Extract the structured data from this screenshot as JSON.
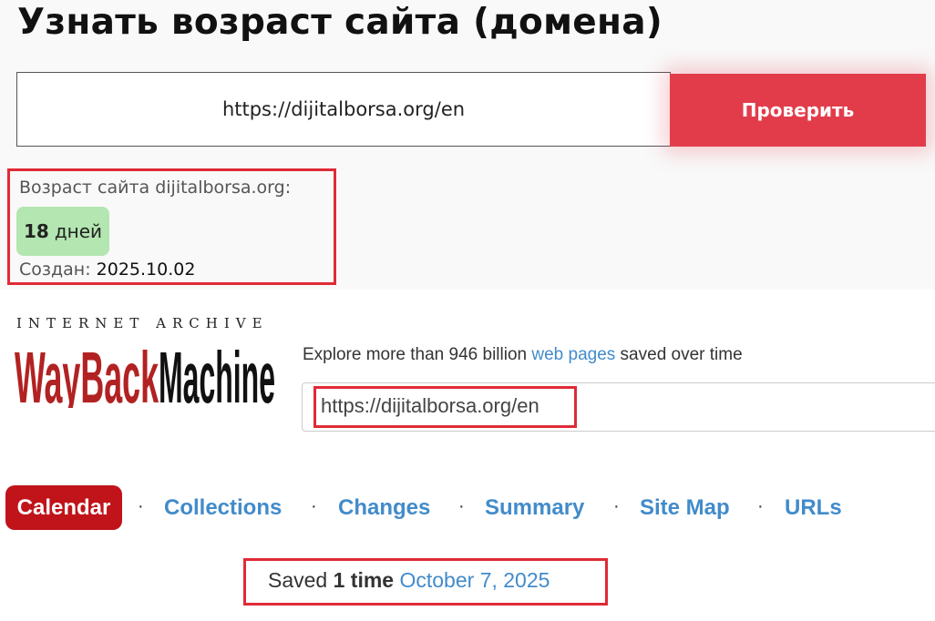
{
  "age_checker": {
    "title": "Узнать возраст сайта (домена)",
    "url_input_value": "https://dijitalborsa.org/en",
    "check_button_label": "Проверить",
    "result_label": "Возраст сайта dijitalborsa.org:",
    "age_value": "18",
    "age_unit": "дней",
    "created_label": "Создан:",
    "created_date": "2025.10.02",
    "colors": {
      "button": "#e23c4b",
      "badge": "#b3e6b1",
      "highlight": "#e02a37"
    }
  },
  "wayback": {
    "org_text": "INTERNET ARCHIVE",
    "logo_left": "WayBack",
    "logo_right": "Machine",
    "explore_before": "Explore more than 946 billion ",
    "explore_link": "web pages",
    "explore_after": " saved over time",
    "search_value": "https://dijitalborsa.org/en",
    "tabs": [
      {
        "label": "Calendar",
        "active": true
      },
      {
        "label": "Collections"
      },
      {
        "label": "Changes"
      },
      {
        "label": "Summary"
      },
      {
        "label": "Site Map"
      },
      {
        "label": "URLs"
      }
    ],
    "tab_separator": "·",
    "saved_prefix": "Saved",
    "saved_count": "1 time",
    "saved_date": "October 7, 2025",
    "colors": {
      "logo_red": "#b22222",
      "logo_black": "#111111",
      "link": "#428bca",
      "active_tab": "#c0141a"
    }
  }
}
